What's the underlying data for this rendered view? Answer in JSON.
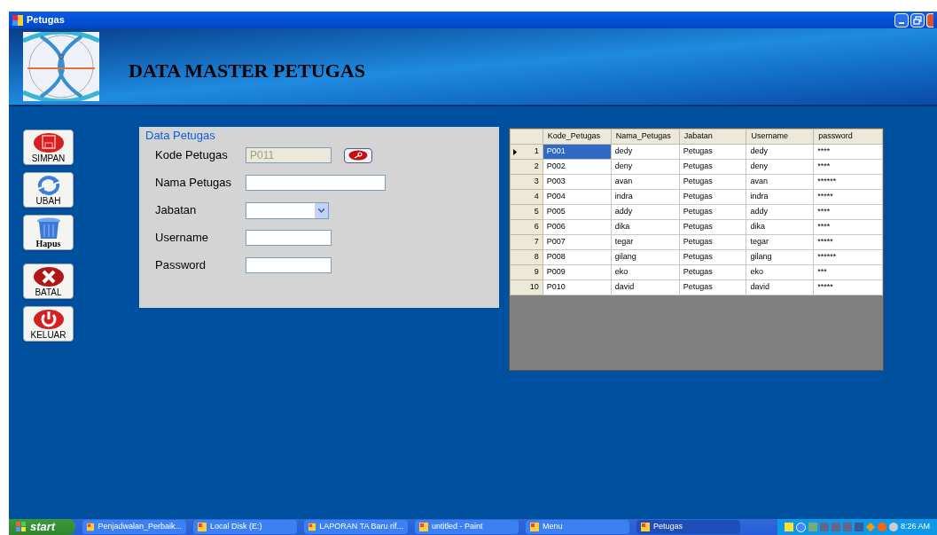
{
  "window": {
    "title": "Petugas"
  },
  "banner": {
    "title": "DATA MASTER PETUGAS"
  },
  "side_buttons": [
    {
      "label": "SIMPAN",
      "kind": "save"
    },
    {
      "label": "UBAH",
      "kind": "refresh"
    },
    {
      "label": "Hapus",
      "kind": "trash"
    },
    {
      "label": "BATAL",
      "kind": "cancel"
    },
    {
      "label": "KELUAR",
      "kind": "power"
    }
  ],
  "form": {
    "title": "Data Petugas",
    "fields": [
      {
        "label": "Kode Petugas",
        "kind": "text",
        "value": "P011",
        "disabled": true,
        "has_button": true
      },
      {
        "label": "Nama Petugas",
        "kind": "text",
        "disabled": false
      },
      {
        "label": "Jabatan",
        "kind": "combo",
        "disabled": false
      },
      {
        "label": "Username",
        "kind": "text",
        "disabled": false
      },
      {
        "label": "Password",
        "kind": "text",
        "disabled": false
      }
    ]
  },
  "table": {
    "columns": [
      "Kode_Petugas",
      "Nama_Petugas",
      "Jabatan",
      "Username",
      "password"
    ],
    "rows": [
      {
        "number": "1",
        "selected": true,
        "cells": [
          "P001",
          "dedy",
          "Petugas",
          "dedy",
          "****"
        ]
      },
      {
        "number": "2",
        "selected": false,
        "cells": [
          "P002",
          "deny",
          "Petugas",
          "deny",
          "****"
        ]
      },
      {
        "number": "3",
        "selected": false,
        "cells": [
          "P003",
          "avan",
          "Petugas",
          "avan",
          "******"
        ]
      },
      {
        "number": "4",
        "selected": false,
        "cells": [
          "P004",
          "indra",
          "Petugas",
          "indra",
          "*****"
        ]
      },
      {
        "number": "5",
        "selected": false,
        "cells": [
          "P005",
          "addy",
          "Petugas",
          "addy",
          "****"
        ]
      },
      {
        "number": "6",
        "selected": false,
        "cells": [
          "P006",
          "dika",
          "Petugas",
          "dika",
          "****"
        ]
      },
      {
        "number": "7",
        "selected": false,
        "cells": [
          "P007",
          "tegar",
          "Petugas",
          "tegar",
          "*****"
        ]
      },
      {
        "number": "8",
        "selected": false,
        "cells": [
          "P008",
          "gilang",
          "Petugas",
          "gilang",
          "******"
        ]
      },
      {
        "number": "9",
        "selected": false,
        "cells": [
          "P009",
          "eko",
          "Petugas",
          "eko",
          "***"
        ]
      },
      {
        "number": "10",
        "selected": false,
        "cells": [
          "P010",
          "david",
          "Petugas",
          "david",
          "*****"
        ]
      }
    ]
  },
  "taskbar": {
    "start": "start",
    "tasks": [
      {
        "label": "Penjadwalan_Perbaik...",
        "selected": false
      },
      {
        "label": "Local Disk (E:)",
        "selected": false
      },
      {
        "label": "LAPORAN TA Baru rif...",
        "selected": false
      },
      {
        "label": "untitled - Paint",
        "selected": false
      },
      {
        "label": "Menu",
        "selected": false
      },
      {
        "label": "Petugas",
        "selected": true
      }
    ],
    "clock": "8:26 AM"
  }
}
